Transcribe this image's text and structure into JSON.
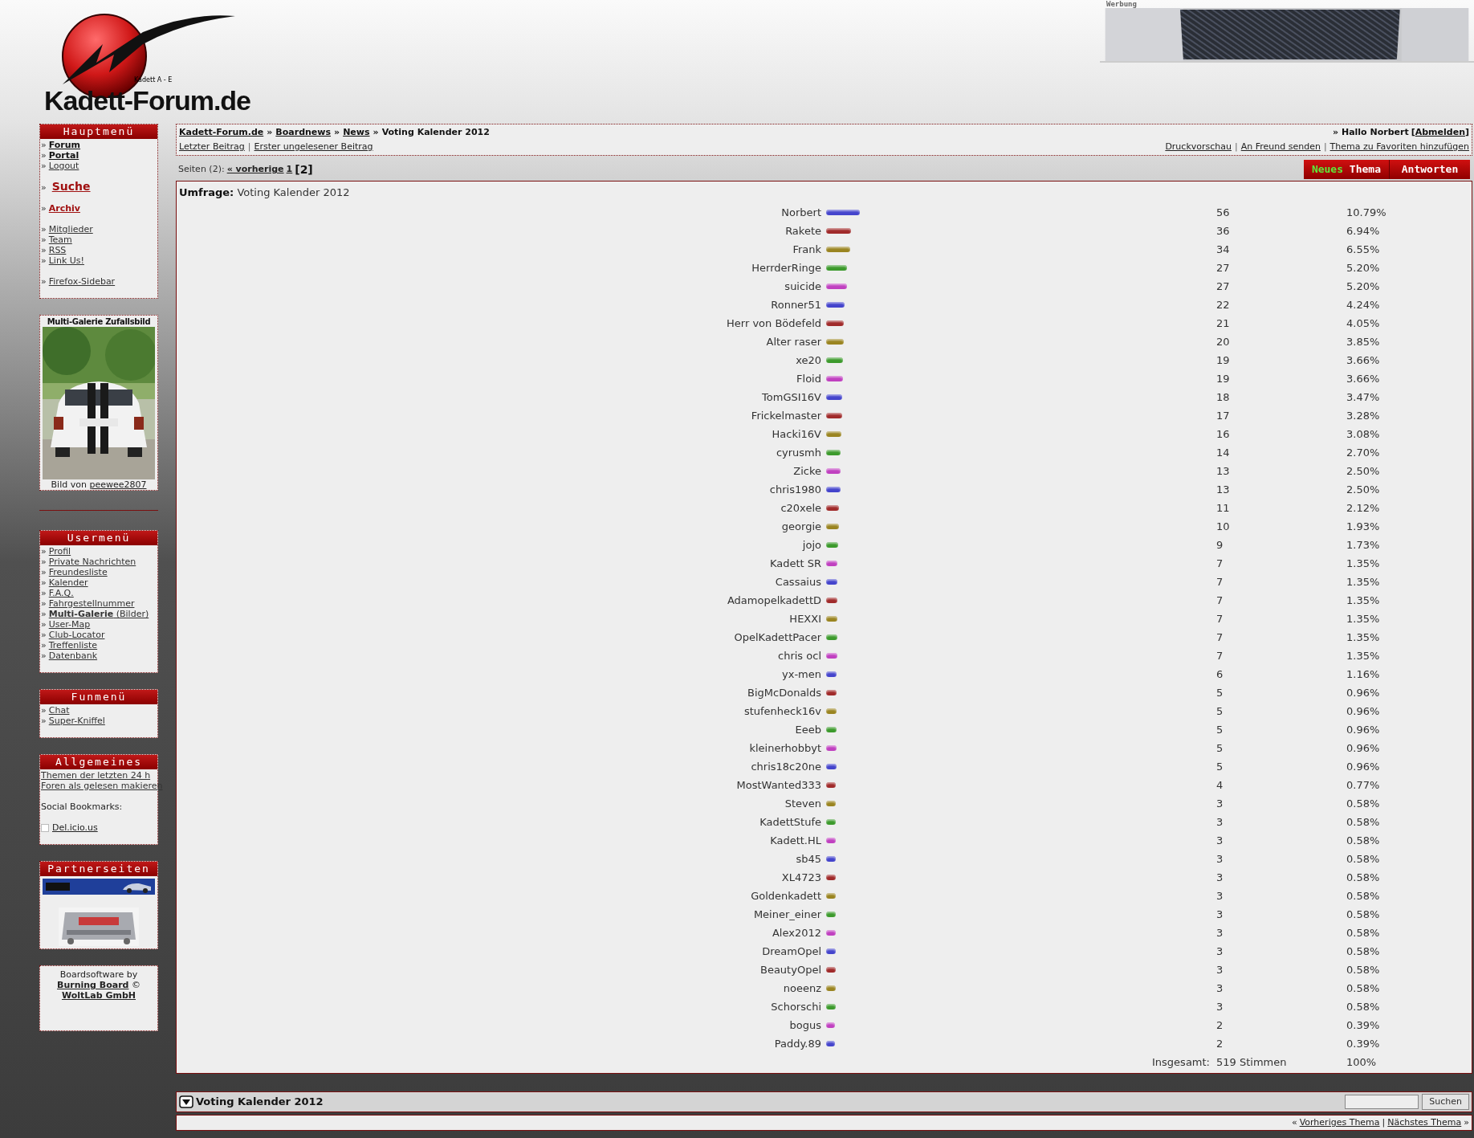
{
  "header": {
    "logo_text": "Kadett-Forum.de",
    "logo_subtitle": "Kadett A - E",
    "ad_label": "Werbung"
  },
  "sidebar": [
    {
      "kind": "menu",
      "title": "Hauptmenü",
      "bullet": "»",
      "groups": [
        [
          {
            "label": "Forum",
            "kind": "bold"
          },
          {
            "label": "Portal",
            "kind": "bold"
          },
          {
            "label": "Logout",
            "kind": "link"
          }
        ],
        [
          {
            "label": "Suche",
            "kind": "accent-large"
          }
        ],
        [
          {
            "label": "Archiv",
            "kind": "accent"
          }
        ],
        [
          {
            "label": "Mitglieder",
            "kind": "link"
          },
          {
            "label": "Team",
            "kind": "link"
          },
          {
            "label": "RSS",
            "kind": "link"
          },
          {
            "label": "Link Us!",
            "kind": "link"
          }
        ],
        [
          {
            "label": "Firefox-Sidebar",
            "kind": "link"
          }
        ]
      ]
    },
    {
      "kind": "gallery",
      "title": "Multi-Galerie Zufallsbild",
      "caption": "Bild von",
      "caption_link": "peewee2807"
    },
    {
      "kind": "rule"
    },
    {
      "kind": "menu",
      "title": "Usermenü",
      "bullet": "»",
      "groups": [
        [
          {
            "label": "Profil",
            "kind": "link"
          },
          {
            "label": "Private Nachrichten",
            "kind": "link"
          },
          {
            "label": "Freundesliste",
            "kind": "link"
          },
          {
            "label": "Kalender",
            "kind": "link"
          },
          {
            "label": "F.A.Q.",
            "kind": "link"
          },
          {
            "label": "Fahrgestellnummer",
            "kind": "link"
          },
          {
            "label": "**Multi-Galerie** (Bilder)",
            "kind": "link"
          },
          {
            "label": "User-Map",
            "kind": "link"
          },
          {
            "label": "Club-Locator",
            "kind": "link"
          },
          {
            "label": "Treffenliste",
            "kind": "link"
          },
          {
            "label": "Datenbank",
            "kind": "link"
          }
        ]
      ]
    },
    {
      "kind": "menu",
      "title": "Funmenü",
      "bullet": "»",
      "groups": [
        [
          {
            "label": "Chat",
            "kind": "link"
          },
          {
            "label": "Super-Kniffel",
            "kind": "link"
          }
        ]
      ]
    },
    {
      "kind": "menu",
      "title": "Allgemeines",
      "groups": [
        [
          {
            "label": "Themen der letzten 24 h",
            "kind": "link"
          },
          {
            "label": "Foren als gelesen makieren",
            "kind": "link"
          }
        ],
        [
          {
            "label": "Social Bookmarks:",
            "kind": "text"
          }
        ],
        [
          {
            "label": "Del.icio.us",
            "kind": "bookmark"
          }
        ]
      ]
    },
    {
      "kind": "partners",
      "title": "Partnerseiten"
    },
    {
      "kind": "credits",
      "text": "Boardsoftware by",
      "link": "Burning Board",
      "copyright": "©",
      "company": "WoltLab GmbH"
    }
  ],
  "breadcrumb": {
    "separator": "»",
    "items": [
      "Kadett-Forum.de",
      "Boardnews",
      "News"
    ],
    "current": "Voting Kalender 2012"
  },
  "greeting": {
    "text": "» Hallo Norbert",
    "open": "[",
    "link": "Abmelden",
    "close": "]"
  },
  "thread_links": {
    "separator": "|",
    "left": [
      "Letzter Beitrag",
      "Erster ungelesener Beitrag"
    ],
    "right": [
      "Druckvorschau",
      "An Freund senden",
      "Thema zu Favoriten hinzufügen"
    ]
  },
  "pages": {
    "label": "Seiten (2):",
    "items": [
      {
        "label": "« vorherige",
        "selected": false
      },
      {
        "label": "1",
        "selected": false
      },
      {
        "label": "[2]",
        "selected": true
      }
    ]
  },
  "buttons": {
    "new_topic_a": "Neues",
    "new_topic_b": "Thema",
    "reply": "Antworten"
  },
  "poll": {
    "label": "Umfrage:",
    "title": "Voting Kalender 2012",
    "options": [
      {
        "name": "Norbert",
        "votes": "56",
        "percent": "10.79%",
        "color": "#4444cc"
      },
      {
        "name": "Rakete",
        "votes": "36",
        "percent": "6.94%",
        "color": "#a02a2a"
      },
      {
        "name": "Frank",
        "votes": "34",
        "percent": "6.55%",
        "color": "#9a8420"
      },
      {
        "name": "HerrderRinge",
        "votes": "27",
        "percent": "5.20%",
        "color": "#3c9a2c"
      },
      {
        "name": "suicide",
        "votes": "27",
        "percent": "5.20%",
        "color": "#c040c0"
      },
      {
        "name": "Ronner51",
        "votes": "22",
        "percent": "4.24%",
        "color": "#4444cc"
      },
      {
        "name": "Herr von Bödefeld",
        "votes": "21",
        "percent": "4.05%",
        "color": "#a02a2a"
      },
      {
        "name": "Alter raser",
        "votes": "20",
        "percent": "3.85%",
        "color": "#9a8420"
      },
      {
        "name": "xe20",
        "votes": "19",
        "percent": "3.66%",
        "color": "#3c9a2c"
      },
      {
        "name": "Floid",
        "votes": "19",
        "percent": "3.66%",
        "color": "#c040c0"
      },
      {
        "name": "TomGSI16V",
        "votes": "18",
        "percent": "3.47%",
        "color": "#4444cc"
      },
      {
        "name": "Frickelmaster",
        "votes": "17",
        "percent": "3.28%",
        "color": "#a02a2a"
      },
      {
        "name": "Hacki16V",
        "votes": "16",
        "percent": "3.08%",
        "color": "#9a8420"
      },
      {
        "name": "cyrusmh",
        "votes": "14",
        "percent": "2.70%",
        "color": "#3c9a2c"
      },
      {
        "name": "Zicke",
        "votes": "13",
        "percent": "2.50%",
        "color": "#c040c0"
      },
      {
        "name": "chris1980",
        "votes": "13",
        "percent": "2.50%",
        "color": "#4444cc"
      },
      {
        "name": "c20xele",
        "votes": "11",
        "percent": "2.12%",
        "color": "#a02a2a"
      },
      {
        "name": "georgie",
        "votes": "10",
        "percent": "1.93%",
        "color": "#9a8420"
      },
      {
        "name": "jojo",
        "votes": "9",
        "percent": "1.73%",
        "color": "#3c9a2c"
      },
      {
        "name": "Kadett SR",
        "votes": "7",
        "percent": "1.35%",
        "color": "#c040c0"
      },
      {
        "name": "Cassaius",
        "votes": "7",
        "percent": "1.35%",
        "color": "#4444cc"
      },
      {
        "name": "AdamopelkadettD",
        "votes": "7",
        "percent": "1.35%",
        "color": "#a02a2a"
      },
      {
        "name": "HEXXI",
        "votes": "7",
        "percent": "1.35%",
        "color": "#9a8420"
      },
      {
        "name": "OpelKadettPacer",
        "votes": "7",
        "percent": "1.35%",
        "color": "#3c9a2c"
      },
      {
        "name": "chris ocl",
        "votes": "7",
        "percent": "1.35%",
        "color": "#c040c0"
      },
      {
        "name": "yx-men",
        "votes": "6",
        "percent": "1.16%",
        "color": "#4444cc"
      },
      {
        "name": "BigMcDonalds",
        "votes": "5",
        "percent": "0.96%",
        "color": "#a02a2a"
      },
      {
        "name": "stufenheck16v",
        "votes": "5",
        "percent": "0.96%",
        "color": "#9a8420"
      },
      {
        "name": "Eeeb",
        "votes": "5",
        "percent": "0.96%",
        "color": "#3c9a2c"
      },
      {
        "name": "kleinerhobbyt",
        "votes": "5",
        "percent": "0.96%",
        "color": "#c040c0"
      },
      {
        "name": "chris18c20ne",
        "votes": "5",
        "percent": "0.96%",
        "color": "#4444cc"
      },
      {
        "name": "MostWanted333",
        "votes": "4",
        "percent": "0.77%",
        "color": "#a02a2a"
      },
      {
        "name": "Steven",
        "votes": "3",
        "percent": "0.58%",
        "color": "#9a8420"
      },
      {
        "name": "KadettStufe",
        "votes": "3",
        "percent": "0.58%",
        "color": "#3c9a2c"
      },
      {
        "name": "Kadett.HL",
        "votes": "3",
        "percent": "0.58%",
        "color": "#c040c0"
      },
      {
        "name": "sb45",
        "votes": "3",
        "percent": "0.58%",
        "color": "#4444cc"
      },
      {
        "name": "XL4723",
        "votes": "3",
        "percent": "0.58%",
        "color": "#a02a2a"
      },
      {
        "name": "Goldenkadett",
        "votes": "3",
        "percent": "0.58%",
        "color": "#9a8420"
      },
      {
        "name": "Meiner_einer",
        "votes": "3",
        "percent": "0.58%",
        "color": "#3c9a2c"
      },
      {
        "name": "Alex2012",
        "votes": "3",
        "percent": "0.58%",
        "color": "#c040c0"
      },
      {
        "name": "DreamOpel",
        "votes": "3",
        "percent": "0.58%",
        "color": "#4444cc"
      },
      {
        "name": "BeautyOpel",
        "votes": "3",
        "percent": "0.58%",
        "color": "#a02a2a"
      },
      {
        "name": "noeenz",
        "votes": "3",
        "percent": "0.58%",
        "color": "#9a8420"
      },
      {
        "name": "Schorschi",
        "votes": "3",
        "percent": "0.58%",
        "color": "#3c9a2c"
      },
      {
        "name": "bogus",
        "votes": "2",
        "percent": "0.39%",
        "color": "#c040c0"
      },
      {
        "name": "Paddy.89",
        "votes": "2",
        "percent": "0.39%",
        "color": "#4444cc"
      }
    ],
    "total_label": "Insgesamt:",
    "total_votes": "519 Stimmen",
    "total_percent": "100%"
  },
  "thread_footer": {
    "title": "Voting Kalender 2012",
    "search_button": "Suchen"
  },
  "thread_nav": {
    "prev_mark": "«",
    "prev": "Vorheriges Thema",
    "separator": "|",
    "next": "Nächstes Thema",
    "next_mark": "»"
  }
}
